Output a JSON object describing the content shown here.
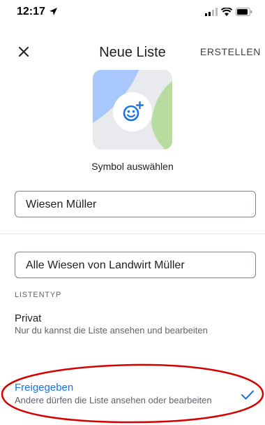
{
  "status_bar": {
    "time": "12:17"
  },
  "appbar": {
    "title": "Neue Liste",
    "create_label": "ERSTELLEN"
  },
  "symbol": {
    "label": "Symbol auswählen",
    "icon": "add-emoji-icon"
  },
  "form": {
    "name_value": "Wiesen Müller",
    "description_value": "Alle Wiesen von Landwirt Müller"
  },
  "list_type": {
    "section_label": "LISTENTYP",
    "options": [
      {
        "title": "Privat",
        "description": "Nur du kannst die Liste ansehen und bearbeiten",
        "selected": false
      },
      {
        "title": "Freigegeben",
        "description": "Andere dürfen die Liste ansehen oder bearbeiten",
        "selected": true
      }
    ]
  },
  "colors": {
    "accent": "#1a73e8",
    "annotation": "#d50000"
  }
}
